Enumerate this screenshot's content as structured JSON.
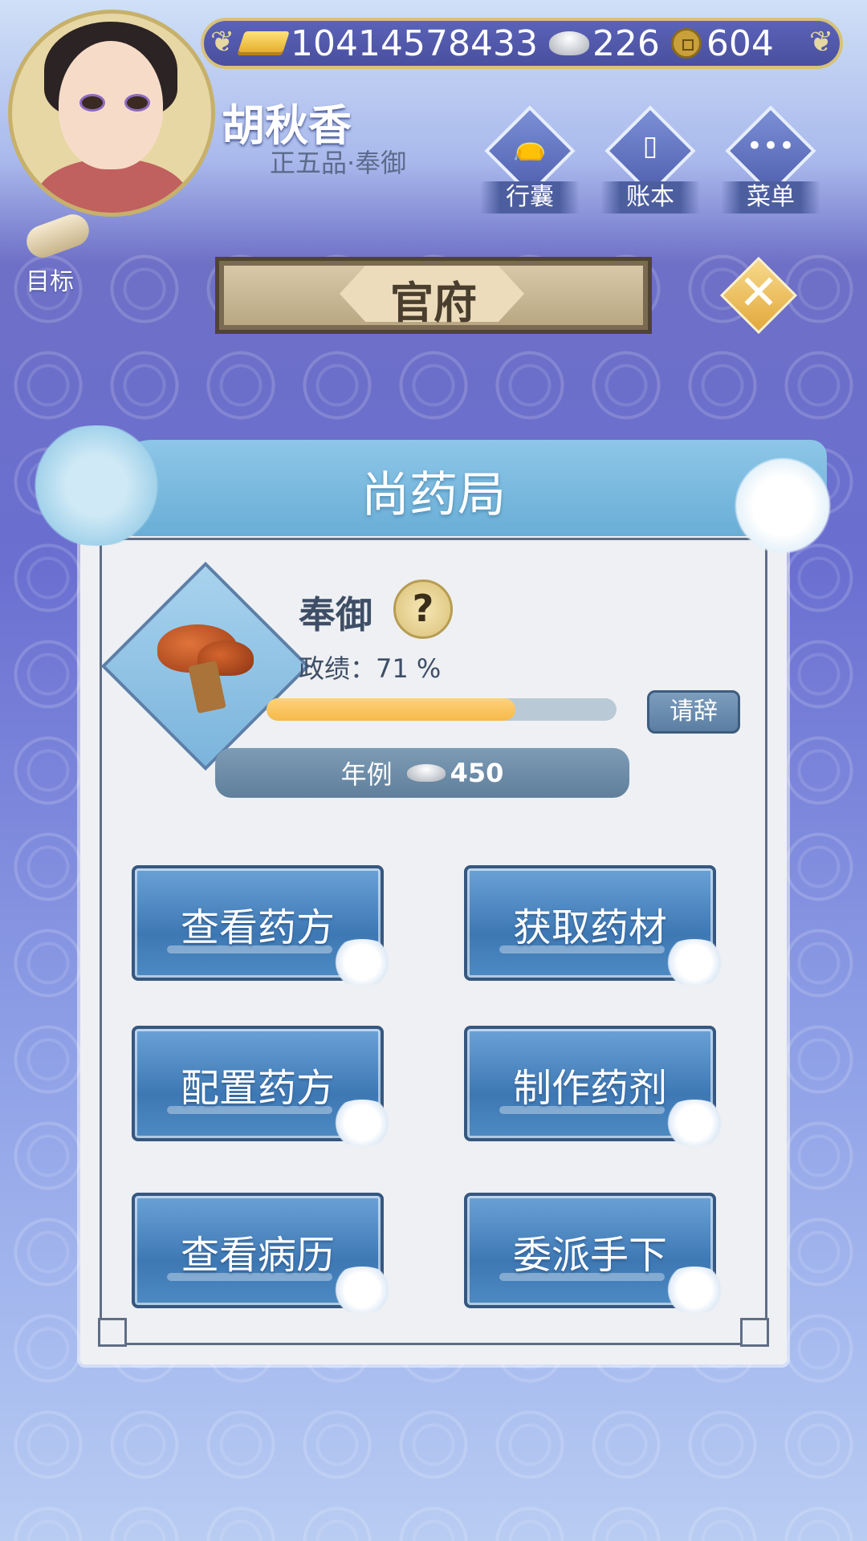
{
  "hud": {
    "gold": "10414578433",
    "silver": "226",
    "coins": "604",
    "player_name": "胡秋香",
    "player_rank": "正五品·奉御",
    "menu": [
      {
        "label": "行囊",
        "icon": "bag-icon"
      },
      {
        "label": "账本",
        "icon": "ledger-icon"
      },
      {
        "label": "菜单",
        "icon": "more-icon"
      }
    ],
    "goal_label": "目标"
  },
  "banner": {
    "title": "官府"
  },
  "panel": {
    "title": "尚药局",
    "position_title": "奉御",
    "merit_label": "政绩：71 %",
    "merit_percent": 71,
    "resign_label": "请辞",
    "salary_label": "年例",
    "salary_value": "450"
  },
  "actions": [
    {
      "label": "查看药方"
    },
    {
      "label": "获取药材"
    },
    {
      "label": "配置药方"
    },
    {
      "label": "制作药剂"
    },
    {
      "label": "查看病历"
    },
    {
      "label": "委派手下"
    }
  ],
  "colors": {
    "accent_gold": "#e2a93d",
    "panel_bg": "#eef0f3",
    "button_blue": "#3e78b4",
    "merit_fill": "#f6b94a"
  }
}
